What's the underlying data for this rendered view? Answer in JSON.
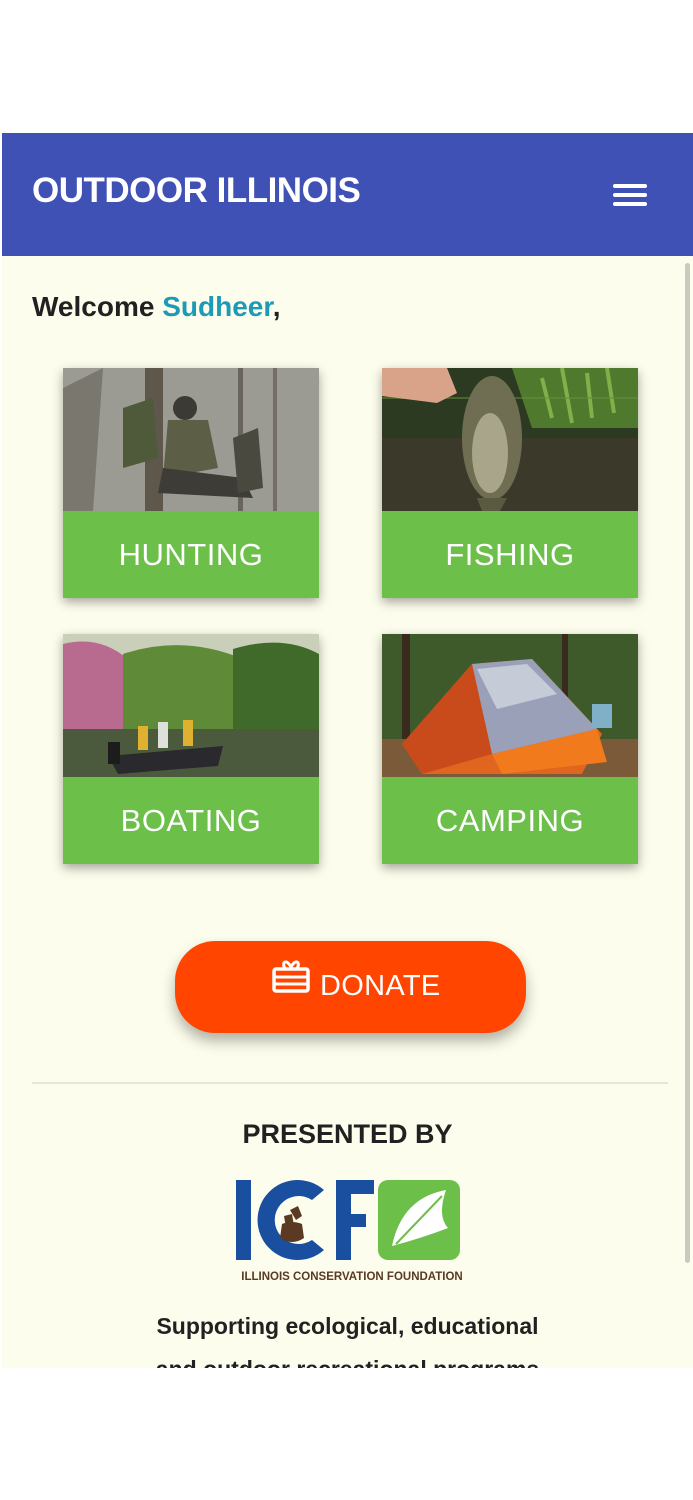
{
  "app_bar": {
    "title": "OUTDOOR ILLINOIS",
    "menu_icon": "hamburger-menu-icon"
  },
  "welcome": {
    "prefix": "Welcome ",
    "user_name": "Sudheer",
    "suffix": ","
  },
  "tiles": [
    {
      "label": "HUNTING",
      "photo": "hunter-in-tree-stand"
    },
    {
      "label": "FISHING",
      "photo": "hand-holding-bass"
    },
    {
      "label": "BOATING",
      "photo": "people-in-boat-on-lake"
    },
    {
      "label": "CAMPING",
      "photo": "orange-tent-in-forest"
    }
  ],
  "donate": {
    "label": "DONATE",
    "icon": "gift-card-icon"
  },
  "footer": {
    "presented_by": "PRESENTED BY",
    "logo": {
      "letters": "ICF",
      "name": "ILLINOIS CONSERVATION FOUNDATION"
    },
    "tagline_line1": "Supporting ecological, educational",
    "tagline_line2": "and outdoor recreational programs"
  },
  "colors": {
    "app_bar": "#3f51b5",
    "background": "#fcfdec",
    "tile_band": "#6cc04a",
    "donate": "#ff4500",
    "user_name": "#1e9ab7",
    "logo_blue": "#1a4fa0",
    "logo_green": "#6cc04a"
  }
}
